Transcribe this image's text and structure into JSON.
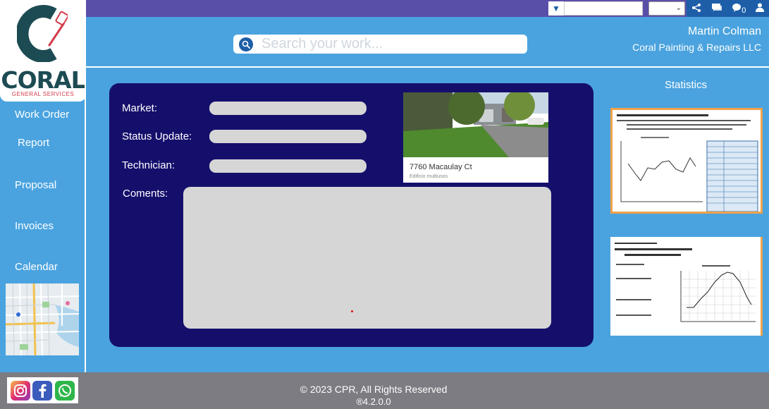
{
  "header": {
    "search_placeholder": "Search your work...",
    "user_name": "Martin Colman",
    "company": "Coral Painting & Repairs LLC",
    "notification_count": "0"
  },
  "logo": {
    "name": "CORAL",
    "tagline": "GENERAL SERVICES"
  },
  "sidebar": {
    "items": [
      {
        "label": "Work Order"
      },
      {
        "label": "Report"
      },
      {
        "label": "Proposal"
      },
      {
        "label": "Invoices"
      },
      {
        "label": "Calendar"
      }
    ]
  },
  "form": {
    "market_label": "Market:",
    "status_label": "Status Update:",
    "technician_label": "Technician:",
    "comments_label": "Coments:"
  },
  "property": {
    "address": "7760 Macaulay Ct",
    "type": "Edificio multiusos"
  },
  "stats": {
    "title": "Statistics"
  },
  "footer": {
    "copyright": "© 2023 CPR, All Rights Reserved",
    "version": "®4.2.0.0"
  },
  "colors": {
    "brand_blue": "#4aa3df",
    "card_navy": "#150f6c",
    "accent_purple": "#5a4fa8",
    "logo_teal": "#1d4b53",
    "logo_red": "#d33c4a"
  }
}
